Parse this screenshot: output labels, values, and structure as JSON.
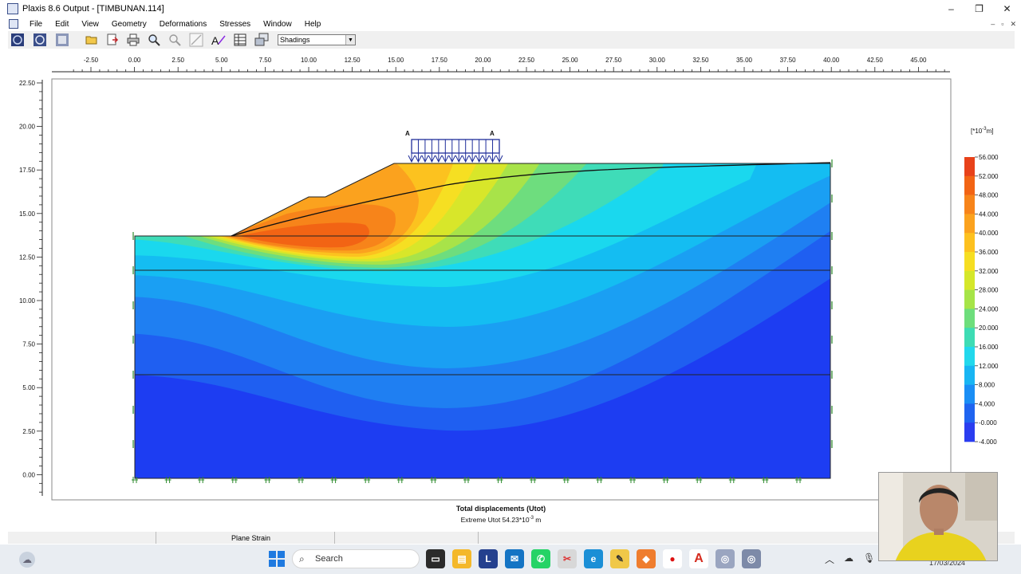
{
  "window": {
    "title": "Plaxis 8.6 Output - [TIMBUNAN.114]",
    "minimize": "–",
    "maximize": "❐",
    "close": "✕"
  },
  "menu": [
    "File",
    "Edit",
    "View",
    "Geometry",
    "Deformations",
    "Stresses",
    "Window",
    "Help"
  ],
  "mdi_controls": [
    "–",
    "▫",
    "✕"
  ],
  "toolbar": {
    "view_select": "Shadings",
    "text_tool": "A"
  },
  "plot": {
    "x_ticks": [
      "-2.50",
      "0.00",
      "2.50",
      "5.00",
      "7.50",
      "10.00",
      "12.50",
      "15.00",
      "17.50",
      "20.00",
      "22.50",
      "25.00",
      "27.50",
      "30.00",
      "32.50",
      "35.00",
      "37.50",
      "40.00",
      "42.50",
      "45.00"
    ],
    "y_ticks": [
      "22.50",
      "20.00",
      "17.50",
      "15.00",
      "12.50",
      "10.00",
      "7.50",
      "5.00",
      "2.50",
      "0.00"
    ],
    "load_label_left": "A",
    "load_label_right": "A",
    "legend_unit": "[*10",
    "legend_unit_exp": "-3",
    "legend_unit_tail": "m]",
    "legend_values": [
      "56.000",
      "52.000",
      "48.000",
      "44.000",
      "40.000",
      "36.000",
      "32.000",
      "28.000",
      "24.000",
      "20.000",
      "16.000",
      "12.000",
      "8.000",
      "4.000",
      "-0.000",
      "-4.000"
    ],
    "legend_colors": [
      "#e8421a",
      "#f26414",
      "#f7841a",
      "#fba21e",
      "#fdc11f",
      "#f6de22",
      "#d5e72a",
      "#a6e448",
      "#6ede7c",
      "#3edcb4",
      "#22d8ec",
      "#18b5f3",
      "#1a8ef5",
      "#1f64f0",
      "#2a3df0"
    ],
    "caption_title": "Total displacements (Utot)",
    "caption_sub": "Extreme Utot 54.23*10",
    "caption_sub_exp": "-3",
    "caption_sub_unit": " m"
  },
  "status": {
    "mode": "Plane Strain"
  },
  "taskbar": {
    "search_placeholder": "Search",
    "clock_date": "17/03/2024"
  }
}
